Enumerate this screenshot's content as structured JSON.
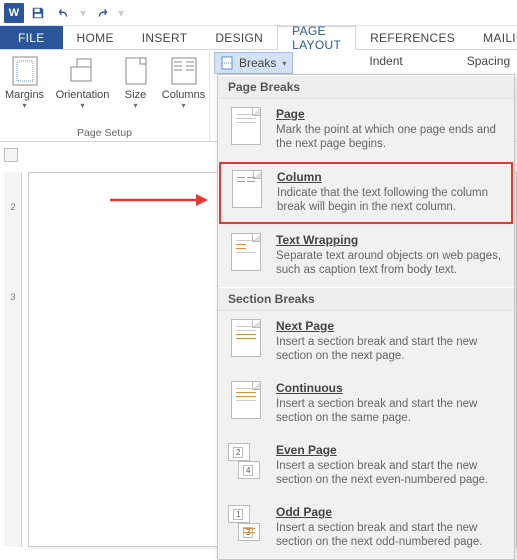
{
  "app_icon_text": "W",
  "tabs": {
    "file": "FILE",
    "home": "HOME",
    "insert": "INSERT",
    "design": "DESIGN",
    "page_layout": "PAGE LAYOUT",
    "references": "REFERENCES",
    "mailings": "MAILIN"
  },
  "ribbon": {
    "margins": "Margins",
    "orientation": "Orientation",
    "size": "Size",
    "columns": "Columns",
    "breaks": "Breaks",
    "page_setup": "Page Setup",
    "indent": "Indent",
    "spacing": "Spacing"
  },
  "dropdown": {
    "page_breaks_header": "Page Breaks",
    "section_breaks_header": "Section Breaks",
    "page": {
      "title": "Page",
      "desc": "Mark the point at which one page ends and the next page begins."
    },
    "column": {
      "title": "Column",
      "desc": "Indicate that the text following the column break will begin in the next column."
    },
    "text_wrapping": {
      "title": "Text Wrapping",
      "desc": "Separate text around objects on web pages, such as caption text from body text."
    },
    "next_page": {
      "title": "Next Page",
      "desc": "Insert a section break and start the new section on the next page."
    },
    "continuous": {
      "title": "Continuous",
      "desc": "Insert a section break and start the new section on the same page."
    },
    "even_page": {
      "title": "Even Page",
      "desc": "Insert a section break and start the new section on the next even-numbered page."
    },
    "odd_page": {
      "title": "Odd Page",
      "desc": "Insert a section break and start the new section on the next odd-numbered page."
    }
  },
  "ruler": {
    "t2": "2",
    "t3": "3"
  },
  "even_icon": {
    "a": "2",
    "b": "4"
  },
  "odd_icon": {
    "a": "1",
    "b": "3"
  }
}
